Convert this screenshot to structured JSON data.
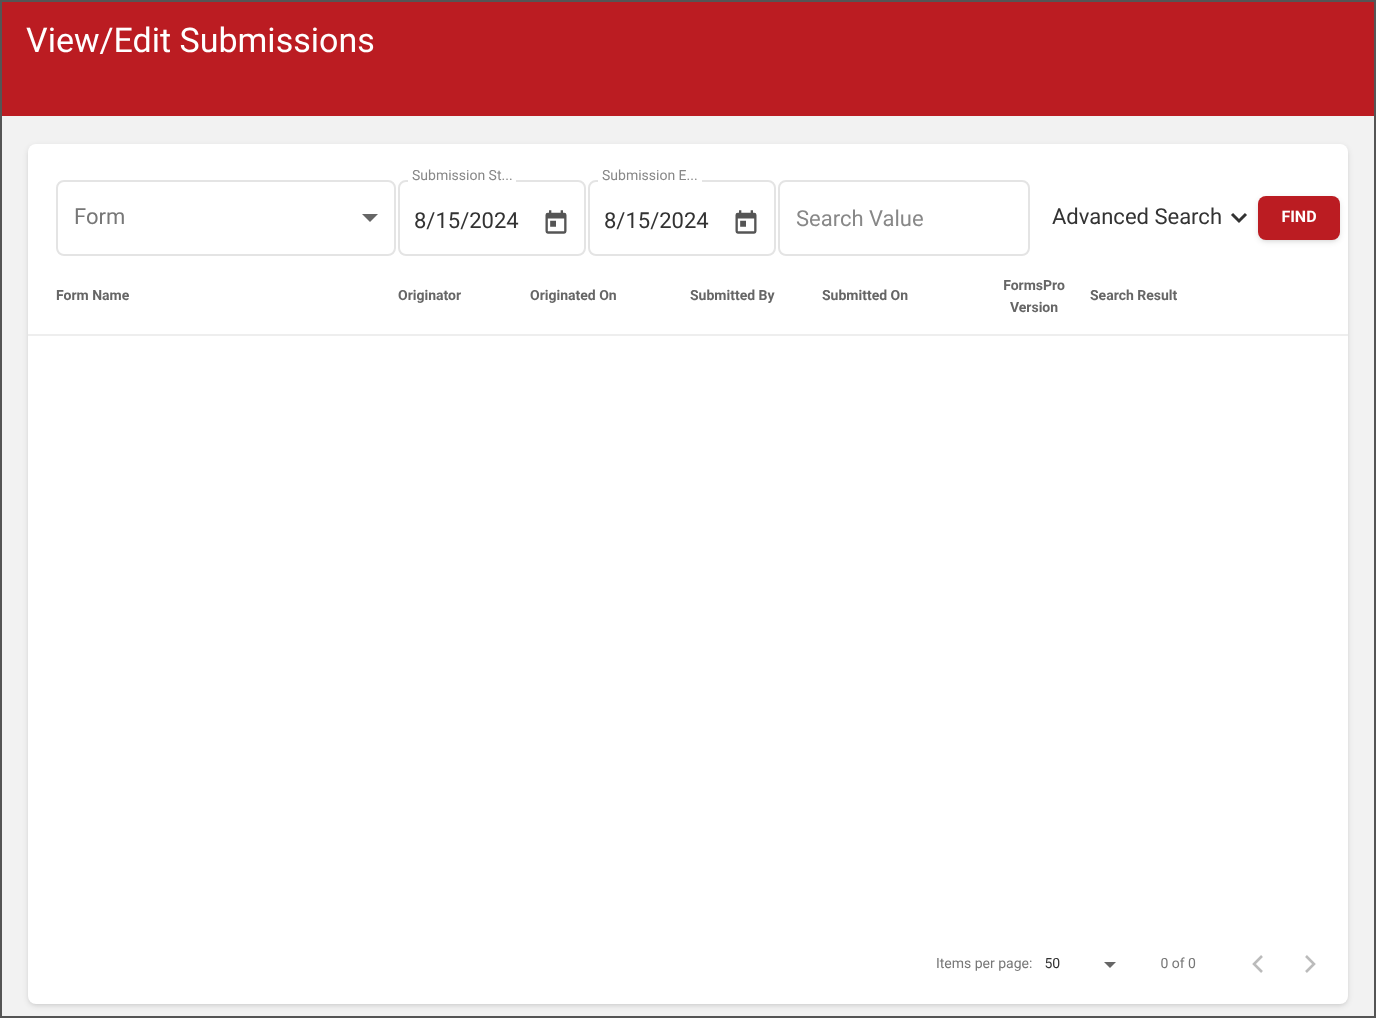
{
  "header": {
    "title": "View/Edit Submissions"
  },
  "filters": {
    "form": {
      "placeholder": "Form"
    },
    "dates": [
      {
        "label": "Submission St...",
        "value": "8/15/2024"
      },
      {
        "label": "Submission E...",
        "value": "8/15/2024"
      }
    ],
    "search": {
      "placeholder": "Search Value"
    },
    "advanced_search": "Advanced Search",
    "find_button": "FIND"
  },
  "table": {
    "columns": [
      "Form Name",
      "Originator",
      "Originated On",
      "Submitted By",
      "Submitted On",
      "FormsPro Version",
      "Search Result"
    ]
  },
  "paginator": {
    "label": "Items per page:",
    "page_size": "50",
    "range": "0 of 0",
    "previous_disabled": true,
    "next_disabled": true
  }
}
